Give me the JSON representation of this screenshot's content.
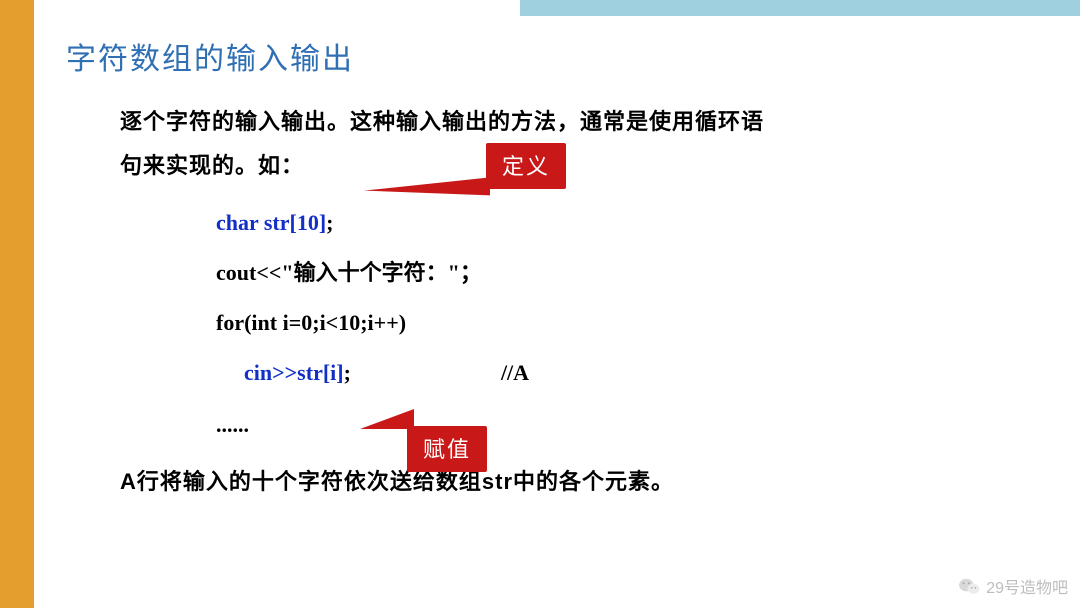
{
  "title": "字符数组的输入输出",
  "intro1": "逐个字符的输入输出。这种输入输出的方法，通常是使用循环语",
  "intro2": "句来实现的。如：",
  "callouts": {
    "def": "定义",
    "assign": "赋值"
  },
  "code": {
    "l1_kw": "char  str[10]",
    "l1_tail": ";",
    "l2a": "cout<<",
    "l2b": "\"",
    "l2c": "输入十个字符：",
    "l2d": "\"",
    "l2e": "；",
    "l3": "for(int i=0;i<10;i++)",
    "l4_kw": "cin>>str[i]",
    "l4_tail": ";",
    "l4_cmt": "//A",
    "dots": "......"
  },
  "bottom": "A行将输入的十个字符依次送给数组str中的各个元素。",
  "watermark": "29号造物吧"
}
